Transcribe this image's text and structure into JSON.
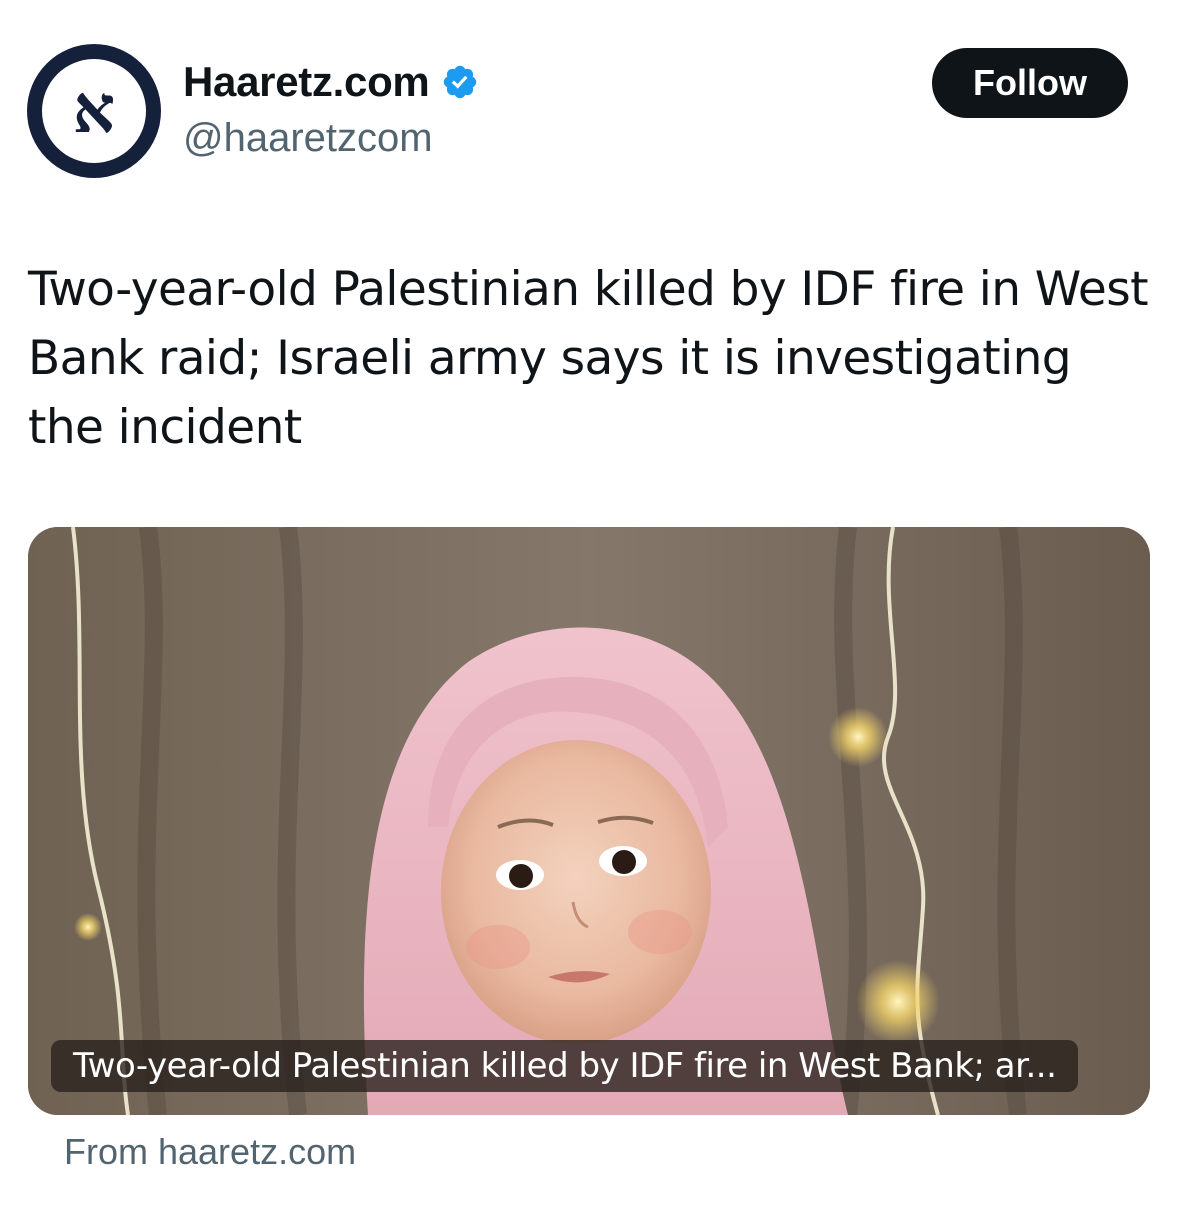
{
  "author": {
    "display_name": "Haaretz.com",
    "handle": "@haaretzcom",
    "avatar_glyph": "א",
    "verified": true,
    "verified_color": "#1d9bf0"
  },
  "follow_button": {
    "label": "Follow"
  },
  "tweet": {
    "text": "Two-year-old Palestinian killed by IDF fire in West Bank raid; Israeli army says it is investigating the incident"
  },
  "link_card": {
    "title": "Two-year-old Palestinian killed by IDF fire in West Bank; ar...",
    "source": "From haaretz.com"
  },
  "colors": {
    "text_primary": "#0f1419",
    "text_secondary": "#536471",
    "button_bg": "#0f1419",
    "avatar_bg": "#15213a"
  }
}
